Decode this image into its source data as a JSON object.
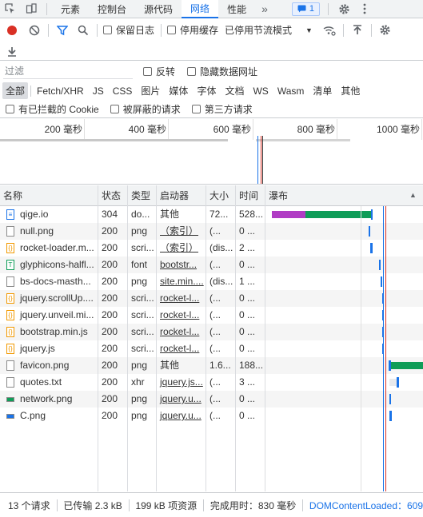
{
  "tabs": [
    {
      "label": "元素",
      "active": false
    },
    {
      "label": "控制台",
      "active": false
    },
    {
      "label": "源代码",
      "active": false
    },
    {
      "label": "网络",
      "active": true
    },
    {
      "label": "性能",
      "active": false
    }
  ],
  "tabs_more": "»",
  "issues_count": "1",
  "toolbar": {
    "preserve_log": "保留日志",
    "disable_cache": "停用缓存",
    "throttle": "已停用节流模式"
  },
  "filter": {
    "placeholder": "过滤",
    "invert": "反转",
    "hide_data_urls": "隐藏数据网址"
  },
  "type_filters": [
    "全部",
    "Fetch/XHR",
    "JS",
    "CSS",
    "图片",
    "媒体",
    "字体",
    "文档",
    "WS",
    "Wasm",
    "清单",
    "其他"
  ],
  "blocked_filters": [
    "有已拦截的 Cookie",
    "被屏蔽的请求",
    "第三方请求"
  ],
  "overview_ticks": [
    "200 毫秒",
    "400 毫秒",
    "600 毫秒",
    "800 毫秒",
    "1000 毫秒"
  ],
  "columns": [
    "名称",
    "状态",
    "类型",
    "启动器",
    "大小",
    "时间",
    "瀑布"
  ],
  "rows": [
    {
      "name": "qige.io",
      "status": "304",
      "type": "do...",
      "initiator": "其他",
      "size": "72...",
      "time": "528...",
      "icon": "document-icon"
    },
    {
      "name": "null.png",
      "status": "200",
      "type": "png",
      "initiator": "（索引）",
      "size": "(...",
      "time": "0 ...",
      "icon": "image-icon"
    },
    {
      "name": "rocket-loader.m...",
      "status": "200",
      "type": "scri...",
      "initiator": "（索引）",
      "size": "(dis...",
      "time": "2 ...",
      "icon": "script-icon"
    },
    {
      "name": "glyphicons-halfl...",
      "status": "200",
      "type": "font",
      "initiator": "bootstr...",
      "size": "(...",
      "time": "0 ...",
      "icon": "font-icon"
    },
    {
      "name": "bs-docs-masth...",
      "status": "200",
      "type": "png",
      "initiator": "site.min....",
      "size": "(dis...",
      "time": "1 ...",
      "icon": "image-icon"
    },
    {
      "name": "jquery.scrollUp....",
      "status": "200",
      "type": "scri...",
      "initiator": "rocket-l...",
      "size": "(...",
      "time": "0 ...",
      "icon": "script-icon"
    },
    {
      "name": "jquery.unveil.mi...",
      "status": "200",
      "type": "scri...",
      "initiator": "rocket-l...",
      "size": "(...",
      "time": "0 ...",
      "icon": "script-icon"
    },
    {
      "name": "bootstrap.min.js",
      "status": "200",
      "type": "scri...",
      "initiator": "rocket-l...",
      "size": "(...",
      "time": "0 ...",
      "icon": "script-icon"
    },
    {
      "name": "jquery.js",
      "status": "200",
      "type": "scri...",
      "initiator": "rocket-l...",
      "size": "(...",
      "time": "0 ...",
      "icon": "script-icon"
    },
    {
      "name": "favicon.png",
      "status": "200",
      "type": "png",
      "initiator": "其他",
      "size": "1.6...",
      "time": "188...",
      "icon": "file-icon"
    },
    {
      "name": "quotes.txt",
      "status": "200",
      "type": "xhr",
      "initiator": "jquery.js...",
      "size": "(...",
      "time": "3 ...",
      "icon": "file-icon"
    },
    {
      "name": "network.png",
      "status": "200",
      "type": "png",
      "initiator": "jquery.u...",
      "size": "(...",
      "time": "0 ...",
      "icon": "image-icon"
    },
    {
      "name": "C.png",
      "status": "200",
      "type": "png",
      "initiator": "jquery.u...",
      "size": "(...",
      "time": "0 ...",
      "icon": "image-icon"
    }
  ],
  "statusbar": {
    "requests": "13 个请求",
    "transferred": "已传输 2.3 kB",
    "resources": "199 kB 项资源",
    "finish": "完成用时：830 毫秒",
    "dcl": "DOMContentLoaded：609"
  },
  "colors": {
    "accent": "#1a73e8",
    "record": "#d93025",
    "waiting": "#b03cc4",
    "download": "#0f9d58",
    "queued": "#1a73e8"
  }
}
